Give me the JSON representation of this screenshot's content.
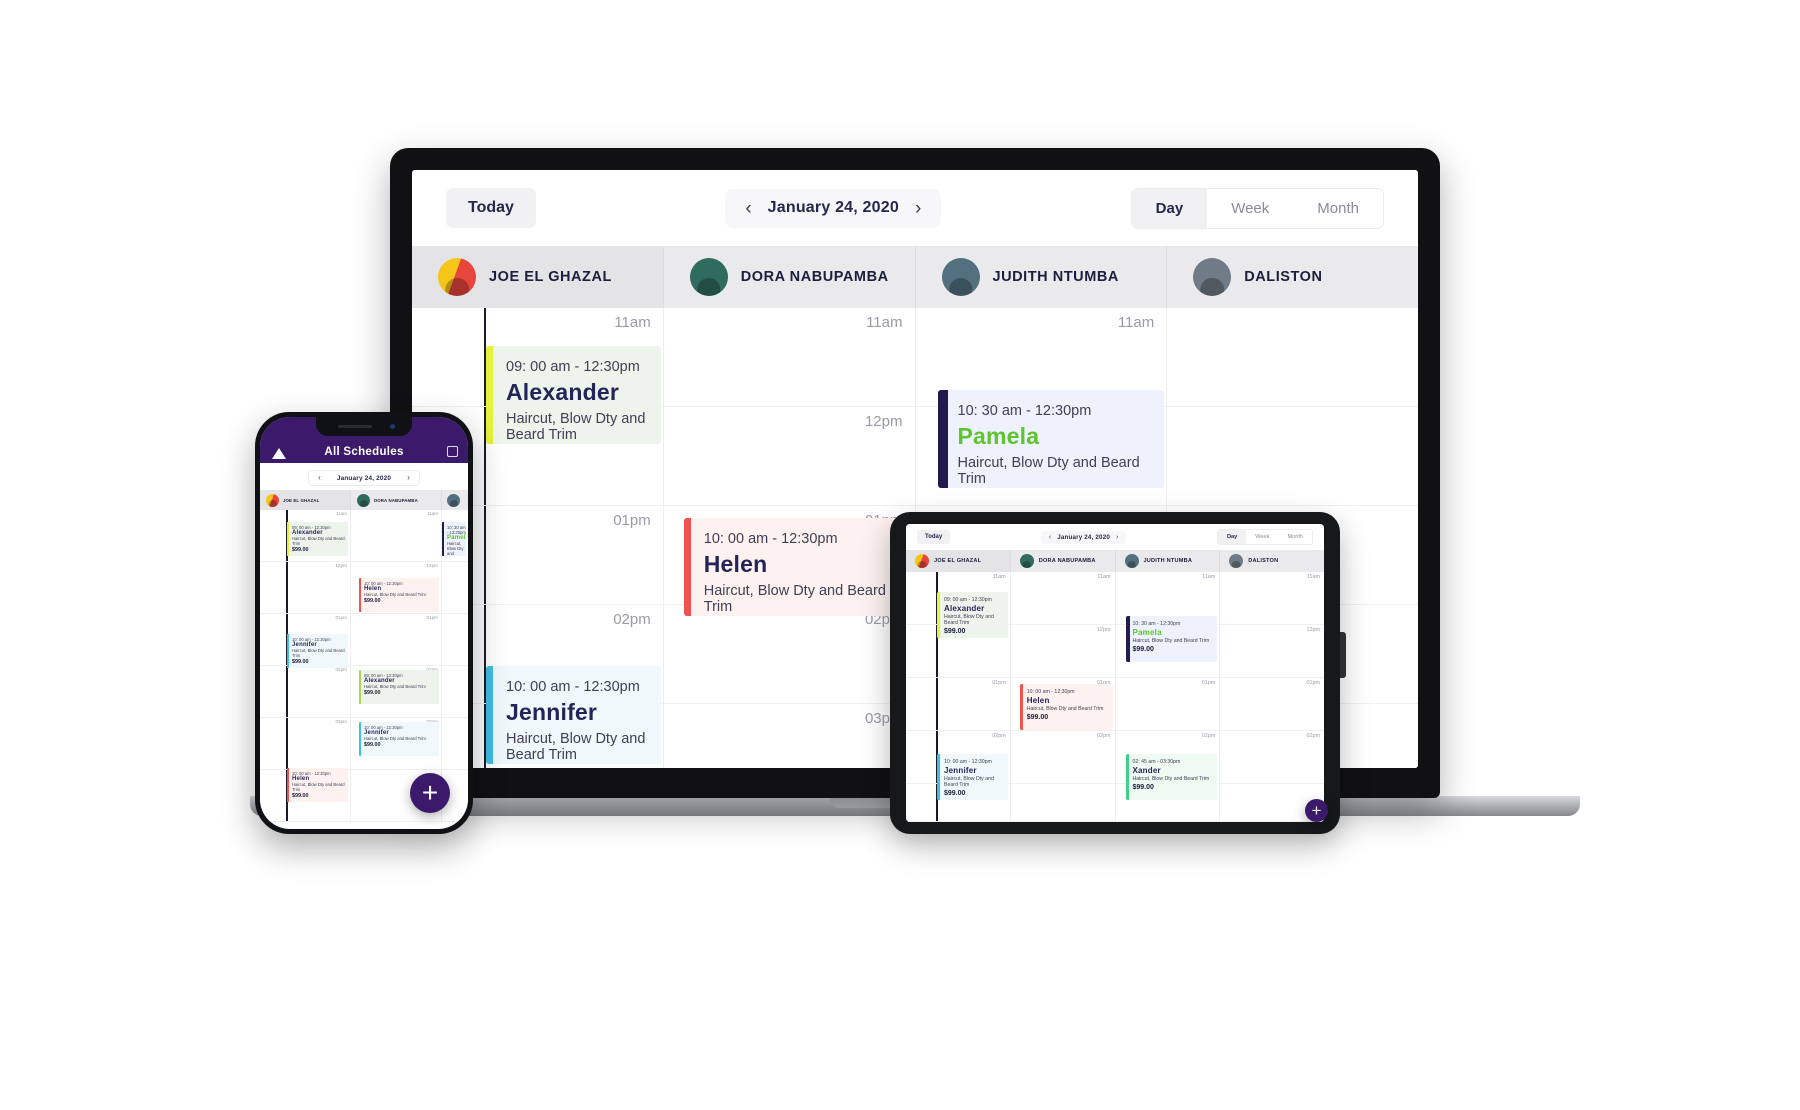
{
  "app": {
    "toolbar": {
      "today_label": "Today",
      "prev_icon": "‹",
      "next_icon": "›",
      "date_label": "January 24, 2020",
      "views": [
        {
          "label": "Day",
          "active": true
        },
        {
          "label": "Week",
          "active": false
        },
        {
          "label": "Month",
          "active": false
        }
      ]
    },
    "staff": [
      {
        "name": "JOE EL GHAZAL",
        "selected": true,
        "avatar": "a1"
      },
      {
        "name": "DORA NABUPAMBA",
        "selected": false,
        "avatar": "a2"
      },
      {
        "name": "JUDITH NTUMBA",
        "selected": false,
        "avatar": "a3"
      },
      {
        "name": "DALISTON",
        "selected": false,
        "avatar": "a4"
      }
    ],
    "time_labels": [
      "11am",
      "12pm",
      "01pm",
      "02pm",
      "03pm"
    ],
    "appointments": [
      {
        "column": 0,
        "time": "09: 00 am - 12:30pm",
        "name": "Alexander",
        "service": "Haircut, Blow Dty and Beard Trim",
        "price": "$99.00",
        "bg": "#edf4ec",
        "bar": "#e4f23a",
        "name_color": "#25245a"
      },
      {
        "column": 2,
        "time": "10: 30 am - 12:30pm",
        "name": "Pamela",
        "service": "Haircut, Blow Dty and Beard Trim",
        "price": "$99.00",
        "bg": "#eef2fc",
        "bar": "#231a4d",
        "name_color": "#5ec430"
      },
      {
        "column": 1,
        "time": "10: 00 am - 12:30pm",
        "name": "Helen",
        "service": "Haircut, Blow Dty and Beard Trim",
        "price": "$99.00",
        "bg": "#fdf2f0",
        "bar": "#f0534f",
        "name_color": "#25245a"
      },
      {
        "column": 0,
        "time": "10: 00 am - 12:30pm",
        "name": "Jennifer",
        "service": "Haircut, Blow Dty and Beard Trim",
        "price": "$99.00",
        "bg": "#f0f8fb",
        "bar": "#3ec0e0",
        "name_color": "#25245a"
      },
      {
        "column": 2,
        "time": "02: 45 am - 03:30pm",
        "name": "Xander",
        "service": "Haircut, Blow Dty and Beard Trim",
        "price": "$99.00",
        "bg": "#eefaf2",
        "bar": "#3fd08a",
        "name_color": "#25245a"
      }
    ],
    "fab_label": "+"
  },
  "phone": {
    "title": "All Schedules",
    "back_icon": "back-triangle",
    "menu_icon": "list-menu"
  }
}
